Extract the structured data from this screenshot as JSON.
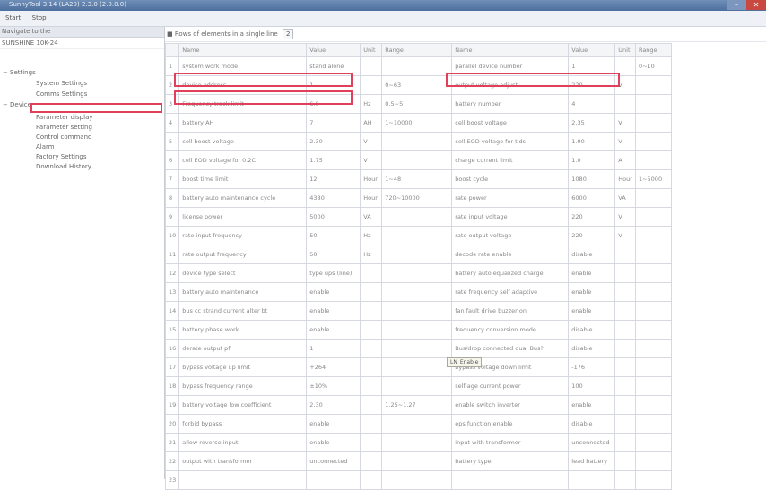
{
  "window": {
    "title": "SunnyTool 3.14 (LA20) 2.3.0 (2.0.0.0)",
    "minimize_icon": "minimize-icon",
    "close_icon": "close-icon"
  },
  "menu": [
    {
      "label": "Start"
    },
    {
      "label": "Stop"
    }
  ],
  "sidebar": {
    "header": "Navigate to the",
    "device": "SUNSHINE 10K-24",
    "tree": [
      {
        "label": "Settings",
        "toggle": "−",
        "level": 0
      },
      {
        "label": "System Settings",
        "level": 1
      },
      {
        "label": "Comms Settings",
        "level": 1
      },
      {
        "label": "Device",
        "toggle": "−",
        "level": 0
      },
      {
        "label": "Parameter display",
        "level": 1
      },
      {
        "label": "Parameter setting",
        "level": 1,
        "selected": true
      },
      {
        "label": "Control command",
        "level": 1
      },
      {
        "label": "Alarm",
        "level": 1
      },
      {
        "label": "Factory Settings",
        "level": 1
      },
      {
        "label": "Download History",
        "level": 1
      }
    ]
  },
  "toolbar": {
    "prefix": "■",
    "label": "Rows of elements in a single line",
    "stepper_value": "2"
  },
  "table": {
    "headers": [
      "",
      "Name",
      "Value",
      "Unit",
      "Range",
      "Name",
      "Value",
      "Unit",
      "Range"
    ],
    "rows": [
      [
        "1",
        "system work mode",
        "stand alone",
        "",
        "",
        "parallel device number",
        "1",
        "",
        "0~10"
      ],
      [
        "2",
        "device address",
        "1",
        "",
        "0~63",
        "output voltage adjust",
        "220",
        "V",
        ""
      ],
      [
        "3",
        "Frequency track limit",
        "6.0",
        "Hz",
        "0.5~5",
        "battery number",
        "4",
        "",
        ""
      ],
      [
        "4",
        "battery AH",
        "7",
        "AH",
        "1~10000",
        "cell boost voltage",
        "2.35",
        "V",
        ""
      ],
      [
        "5",
        "cell boost voltage",
        "2.30",
        "V",
        "",
        "cell EOD voltage for tlds",
        "1.90",
        "V",
        ""
      ],
      [
        "6",
        "cell EOD voltage for 0.2C",
        "1.75",
        "V",
        "",
        "charge current limit",
        "1.0",
        "A",
        ""
      ],
      [
        "7",
        "boost time limit",
        "12",
        "Hour",
        "1~48",
        "boost cycle",
        "1080",
        "Hour",
        "1~5000"
      ],
      [
        "8",
        "battery auto maintenance cycle",
        "4380",
        "Hour",
        "720~10000",
        "rate power",
        "6000",
        "VA",
        ""
      ],
      [
        "9",
        "license power",
        "5000",
        "VA",
        "",
        "rate input voltage",
        "220",
        "V",
        ""
      ],
      [
        "10",
        "rate input frequency",
        "50",
        "Hz",
        "",
        "rate output voltage",
        "220",
        "V",
        ""
      ],
      [
        "11",
        "rate output frequency",
        "50",
        "Hz",
        "",
        "decode rate enable",
        "disable",
        "",
        ""
      ],
      [
        "12",
        "device type select",
        "type ups (line)",
        "",
        "",
        "battery auto equalized charge",
        "enable",
        "",
        ""
      ],
      [
        "13",
        "battery auto maintenance",
        "enable",
        "",
        "",
        "rate frequency self adaptive",
        "enable",
        "",
        ""
      ],
      [
        "14",
        "bus cc strand current alter bt",
        "enable",
        "",
        "",
        "fan fault drive buzzer on",
        "enable",
        "",
        ""
      ],
      [
        "15",
        "battery phase work",
        "enable",
        "",
        "",
        "frequency conversion mode",
        "disable",
        "",
        ""
      ],
      [
        "16",
        "derate output pf",
        "1",
        "",
        "",
        "Bus/drop connected dual Bus?",
        "disable",
        "",
        ""
      ],
      [
        "17",
        "bypass voltage up limit",
        "+264",
        "",
        "",
        "bypass voltage down limit",
        "-176",
        "",
        ""
      ],
      [
        "18",
        "bypass frequency range",
        "±10%",
        "",
        "",
        "self-age current power",
        "100",
        "",
        ""
      ],
      [
        "19",
        "battery voltage low coefficient",
        "2.30",
        "",
        "1.25~1.27",
        "enable switch inverter",
        "enable",
        "",
        ""
      ],
      [
        "20",
        "forbid bypass",
        "enable",
        "",
        "",
        "eps function enable",
        "disable",
        "",
        ""
      ],
      [
        "21",
        "allow reverse input",
        "enable",
        "",
        "",
        "input with transformer",
        "unconnected",
        "",
        ""
      ],
      [
        "22",
        "output with transformer",
        "unconnected",
        "",
        "",
        "battery type",
        "lead battery",
        "",
        ""
      ],
      [
        "23",
        "",
        "",
        "",
        "",
        "",
        "",
        "",
        ""
      ]
    ]
  },
  "tooltip": "LN_Enable"
}
